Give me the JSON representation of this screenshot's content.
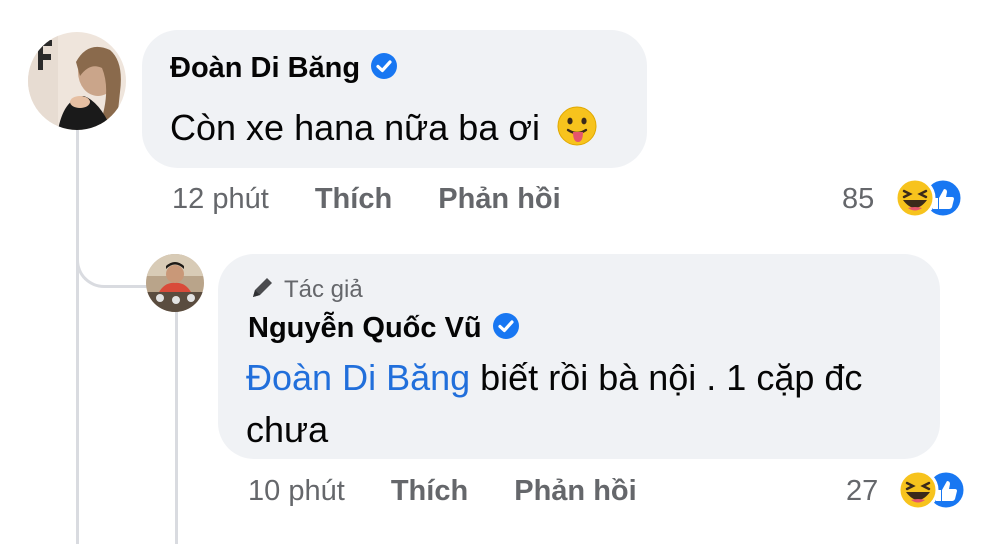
{
  "comment": {
    "author": "Đoàn Di Băng",
    "text": "Còn xe hana nữa ba ơi",
    "emoji": "😛",
    "time": "12 phút",
    "like_label": "Thích",
    "reply_label": "Phản hồi",
    "reaction_count": "85"
  },
  "reply": {
    "badge": "Tác giả",
    "author": "Nguyễn Quốc Vũ",
    "mention": "Đoàn Di Băng",
    "text_line1": " biết rồi bà nội . 1 cặp đc",
    "text_line2": "chưa",
    "time": "10 phút",
    "like_label": "Thích",
    "reply_label": "Phản hồi",
    "reaction_count": "27"
  },
  "colors": {
    "bubble": "#f0f2f5",
    "mention": "#216fdb",
    "verified": "#1877f2",
    "meta": "#65676b"
  },
  "icons": {
    "verified": "verified-badge-icon",
    "author": "pencil-icon",
    "reactions": [
      "haha-icon",
      "like-icon"
    ]
  }
}
